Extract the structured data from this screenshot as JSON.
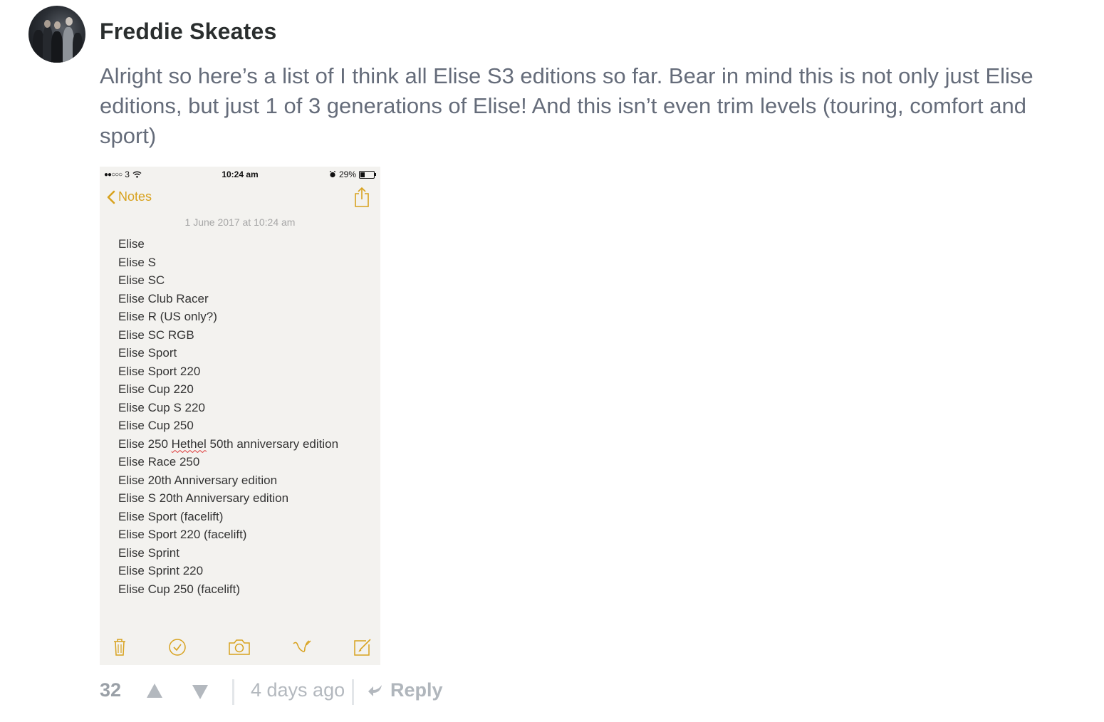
{
  "comment": {
    "author": "Freddie Skeates",
    "text": "Alright so here’s a list of I think all Elise S3 editions so far. Bear in mind this is not only just Elise editions, but just 1 of 3 generations of Elise! And this isn’t even trim levels (touring, comfort and sport)",
    "votes": "32",
    "timestamp": "4 days ago",
    "reply_label": "Reply",
    "upvote_icon": "upvote-icon",
    "downvote_icon": "downvote-icon",
    "reply_icon": "reply-arrow-icon"
  },
  "screenshot": {
    "status": {
      "carrier": "3",
      "signal": "●●○○○",
      "time": "10:24 am",
      "battery": "29%"
    },
    "back_label": "Notes",
    "date": "1 June 2017 at 10:24 am",
    "items": [
      "Elise",
      "Elise S",
      "Elise SC",
      "Elise Club Racer",
      "Elise R (US only?)",
      "Elise SC RGB",
      "Elise Sport",
      "Elise Sport 220",
      "Elise Cup 220",
      "Elise Cup S 220",
      "Elise Cup 250",
      "Elise 250 Hethel 50th anniversary edition",
      "Elise Race 250",
      "Elise 20th Anniversary edition",
      "Elise S 20th Anniversary edition",
      "Elise Sport (facelift)",
      "Elise Sport 220 (facelift)",
      "Elise Sprint",
      "Elise Sprint 220",
      "Elise Cup 250 (facelift)"
    ],
    "hethel_parts": [
      "Elise 250 ",
      "Hethel",
      " 50th anniversary edition"
    ],
    "accent_color": "#d8a21e"
  }
}
